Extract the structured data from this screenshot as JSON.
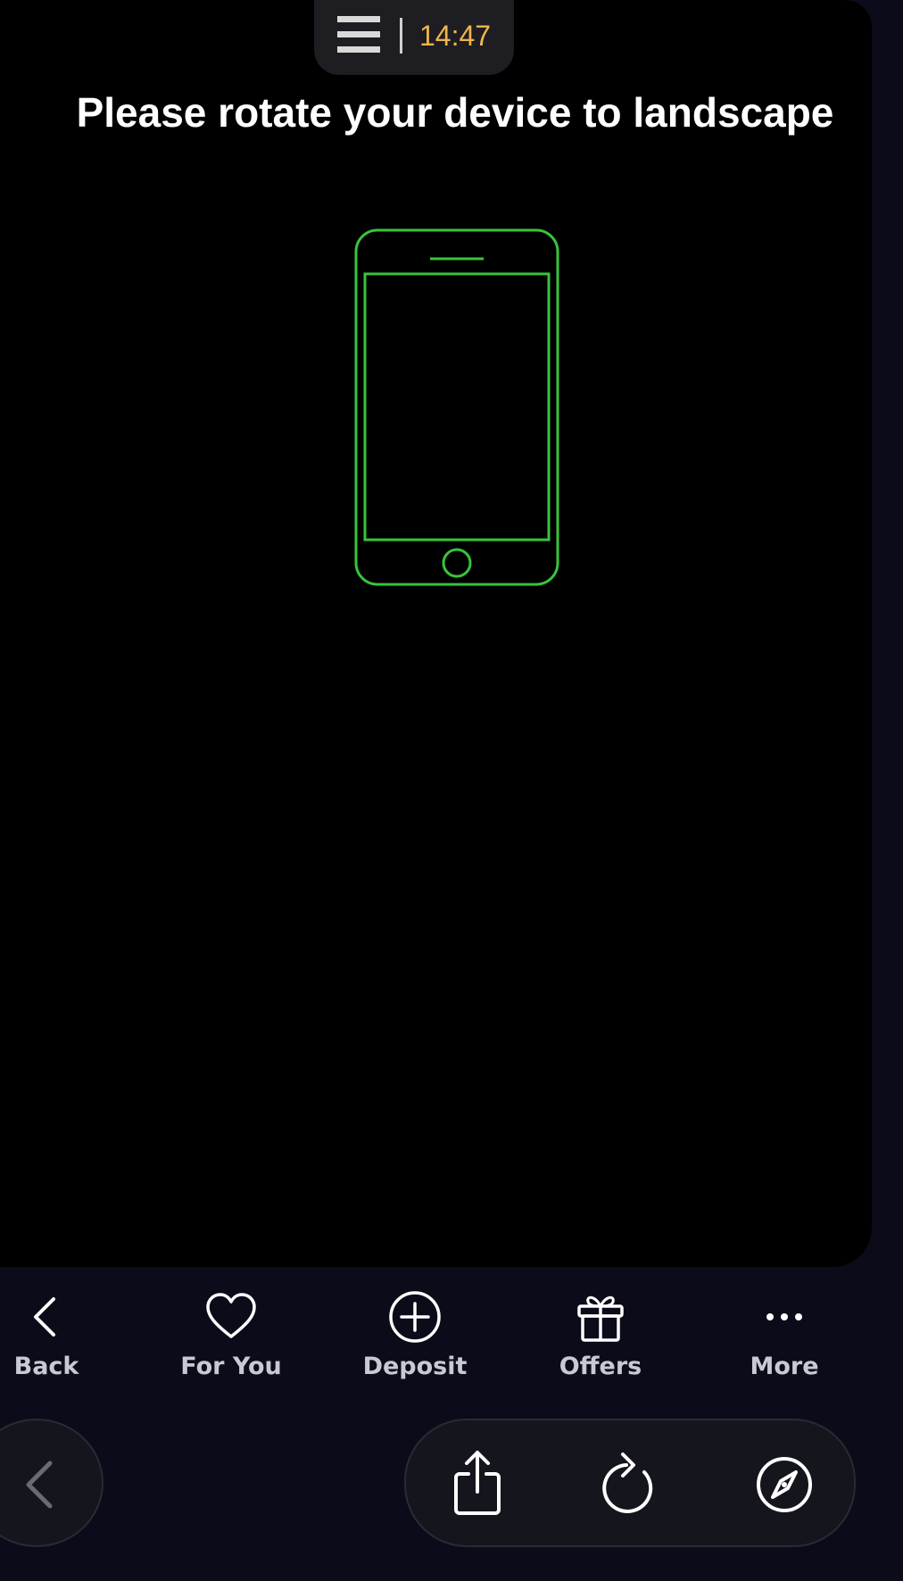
{
  "top_pill": {
    "menu_icon": "hamburger-icon",
    "time": "14:47",
    "time_color": "#f0b54a"
  },
  "message": {
    "text": "Please rotate your device to landscape",
    "icon": "phone-outline-icon",
    "icon_color": "#38c43a"
  },
  "tabbar": {
    "items": [
      {
        "label": "Back",
        "icon": "chevron-left-icon"
      },
      {
        "label": "For You",
        "icon": "heart-icon"
      },
      {
        "label": "Deposit",
        "icon": "plus-circle-icon"
      },
      {
        "label": "Offers",
        "icon": "gift-icon"
      },
      {
        "label": "More",
        "icon": "more-dots-icon"
      }
    ]
  },
  "browser_toolbar": {
    "back_icon": "chevron-left-icon",
    "buttons": [
      {
        "icon": "share-icon"
      },
      {
        "icon": "reload-icon"
      },
      {
        "icon": "compass-icon"
      }
    ]
  }
}
